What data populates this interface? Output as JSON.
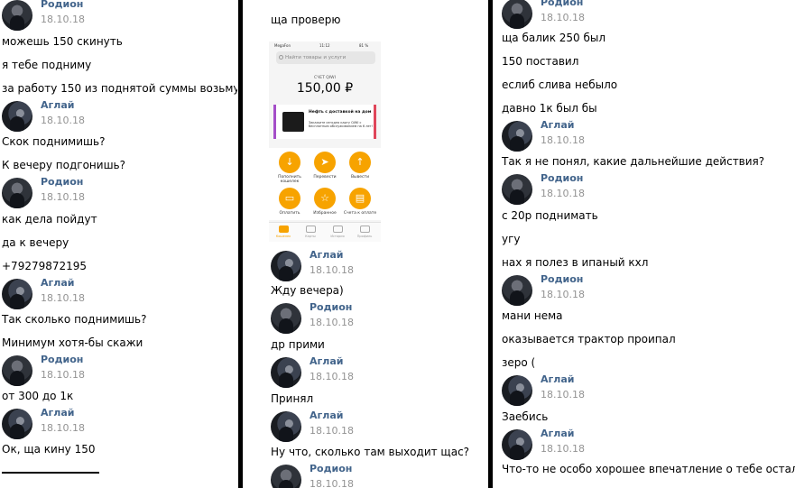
{
  "col1": [
    {
      "type": "head",
      "name": "Родион",
      "date": "18.10.18",
      "avatar": "rodion"
    },
    {
      "type": "text",
      "text": "можешь 150 скинуть"
    },
    {
      "type": "text",
      "text": "я тебе подниму"
    },
    {
      "type": "text",
      "text": "за работу 150 из поднятой суммы возьму"
    },
    {
      "type": "head",
      "name": "Аглай",
      "date": "18.10.18",
      "avatar": "aglay"
    },
    {
      "type": "text",
      "text": "Скок поднимишь?"
    },
    {
      "type": "text",
      "text": "К вечеру подгонишь?"
    },
    {
      "type": "head",
      "name": "Родион",
      "date": "18.10.18",
      "avatar": "rodion"
    },
    {
      "type": "text",
      "text": "как дела пойдут"
    },
    {
      "type": "text",
      "text": "да к вечеру"
    },
    {
      "type": "text",
      "text": "+79279872195"
    },
    {
      "type": "head",
      "name": "Аглай",
      "date": "18.10.18",
      "avatar": "aglay"
    },
    {
      "type": "text",
      "text": "Так сколько поднимишь?"
    },
    {
      "type": "text",
      "text": "Минимум хотя-бы скажи"
    },
    {
      "type": "head",
      "name": "Родион",
      "date": "18.10.18",
      "avatar": "rodion"
    },
    {
      "type": "text",
      "text": "от 300 до 1к"
    },
    {
      "type": "head",
      "name": "Аглай",
      "date": "18.10.18",
      "avatar": "aglay"
    },
    {
      "type": "text",
      "text": "Ок, ща кину 150"
    }
  ],
  "col2": [
    {
      "type": "text",
      "text": "ща проверю"
    },
    {
      "type": "head",
      "name": "Аглай",
      "date": "18.10.18",
      "avatar": "aglay"
    },
    {
      "type": "text",
      "text": "Жду вечера)"
    },
    {
      "type": "head",
      "name": "Родион",
      "date": "18.10.18",
      "avatar": "rodion"
    },
    {
      "type": "text",
      "text": "др прими"
    },
    {
      "type": "head",
      "name": "Аглай",
      "date": "18.10.18",
      "avatar": "aglay"
    },
    {
      "type": "text",
      "text": "Принял"
    },
    {
      "type": "head",
      "name": "Аглай",
      "date": "18.10.18",
      "avatar": "aglay"
    },
    {
      "type": "text",
      "text": "Ну что, сколько там выходит щас?"
    },
    {
      "type": "head",
      "name": "Родион",
      "date": "18.10.18",
      "avatar": "rodion"
    }
  ],
  "col3": [
    {
      "type": "head",
      "name": "Родион",
      "date": "18.10.18",
      "avatar": "rodion"
    },
    {
      "type": "text",
      "text": "ща балик 250 был"
    },
    {
      "type": "text",
      "text": "150 поставил"
    },
    {
      "type": "text",
      "text": "еслиб слива небыло"
    },
    {
      "type": "text",
      "text": "давно 1к был бы"
    },
    {
      "type": "head",
      "name": "Аглай",
      "date": "18.10.18",
      "avatar": "aglay"
    },
    {
      "type": "text",
      "text": "Так я не понял, какие дальнейшие действия?"
    },
    {
      "type": "head",
      "name": "Родион",
      "date": "18.10.18",
      "avatar": "rodion"
    },
    {
      "type": "text",
      "text": "с 20р поднимать"
    },
    {
      "type": "text",
      "text": "угу"
    },
    {
      "type": "text",
      "text": "нах я полез в ипаный кхл"
    },
    {
      "type": "head",
      "name": "Родион",
      "date": "18.10.18",
      "avatar": "rodion"
    },
    {
      "type": "text",
      "text": "мани нема"
    },
    {
      "type": "text",
      "text": "оказывается трактор проипал"
    },
    {
      "type": "text",
      "text": "зеро ("
    },
    {
      "type": "head",
      "name": "Аглай",
      "date": "18.10.18",
      "avatar": "aglay"
    },
    {
      "type": "text",
      "text": "Заебись"
    },
    {
      "type": "head",
      "name": "Аглай",
      "date": "18.10.18",
      "avatar": "aglay"
    },
    {
      "type": "text",
      "text": "Что-то не особо хорошее впечатление о тебе осталось"
    }
  ],
  "phone": {
    "status_carrier": "MegaFon",
    "status_time": "11:12",
    "status_battery": "81 %",
    "search_placeholder": "Найти товары и услуги",
    "balance_label": "СЧЕТ QIWI",
    "balance": "150,00 ₽",
    "promo_title": "Нефть с доставкой на дом",
    "promo_text": "Закажите сегодня карту QIWI с бесплатным обслуживанием на 6 лет!",
    "actions": [
      {
        "label": "Пополнить кошелек",
        "icon": "arrow-down-icon",
        "glyph": "↓"
      },
      {
        "label": "Перевести",
        "icon": "send-icon",
        "glyph": "➤"
      },
      {
        "label": "Вывести",
        "icon": "arrow-up-icon",
        "glyph": "↑"
      },
      {
        "label": "Оплатить",
        "icon": "wallet-icon",
        "glyph": "▭"
      },
      {
        "label": "Избранное",
        "icon": "star-icon",
        "glyph": "☆"
      },
      {
        "label": "Счета к оплате",
        "icon": "bill-icon",
        "glyph": "▤"
      }
    ],
    "tabs": [
      {
        "label": "Кошелек",
        "active": true
      },
      {
        "label": "Карты",
        "active": false
      },
      {
        "label": "История",
        "active": false
      },
      {
        "label": "Профиль",
        "active": false
      }
    ]
  }
}
